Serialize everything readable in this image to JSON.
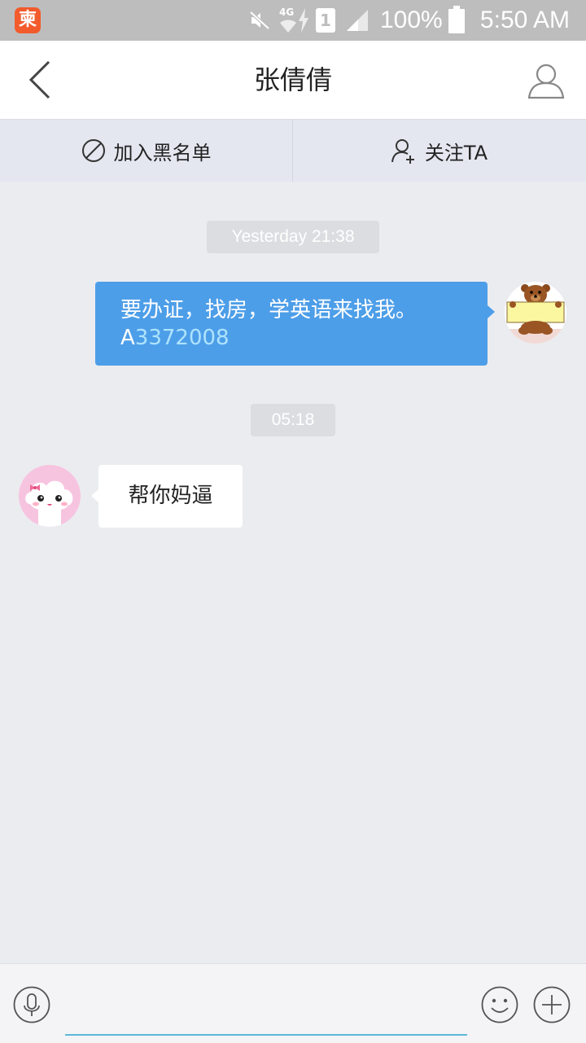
{
  "status_bar": {
    "app_icon_glyph": "柬",
    "network": "4G",
    "sim": "1",
    "battery_percent": "100%",
    "time": "5:50 AM"
  },
  "header": {
    "title": "张倩倩",
    "back_icon": "chevron-left-icon",
    "profile_icon": "person-icon"
  },
  "actions": {
    "blacklist_label": "加入黑名单",
    "follow_label": "关注TA"
  },
  "messages": {
    "timestamp1": "Yesterday 21:38",
    "outgoing_text": "要办证，找房，学英语来找我。",
    "outgoing_prefix": "A",
    "outgoing_link": "3372008",
    "timestamp2": "05:18",
    "incoming_text": "帮你妈逼"
  },
  "input": {
    "value": "",
    "placeholder": ""
  },
  "colors": {
    "accent_blue": "#4d9ee8",
    "status_bar": "#bdbdbd",
    "background": "#ebecf0"
  }
}
